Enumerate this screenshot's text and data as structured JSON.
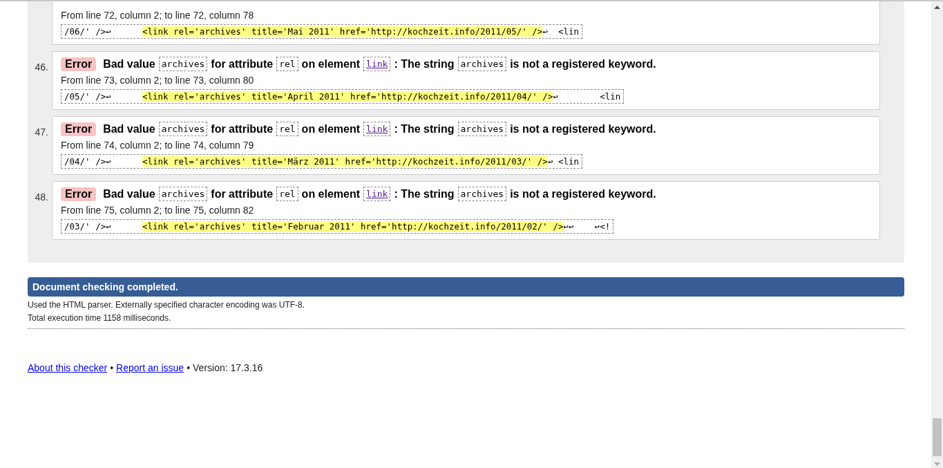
{
  "messages": [
    {
      "location": "From line 72, column 2; to line 72, column 78",
      "extract": {
        "before": "/06/' />↩      ",
        "highlighted": "<link rel='archives' title='Mai 2011' href='http://kochzeit.info/2011/05/' />",
        "after": "↩  <lin"
      }
    },
    {
      "number": "46.",
      "type": "Error",
      "parts": [
        {
          "kind": "text",
          "text": "Bad value"
        },
        {
          "kind": "code",
          "text": "archives"
        },
        {
          "kind": "text",
          "text": "for attribute"
        },
        {
          "kind": "code",
          "text": "rel"
        },
        {
          "kind": "text",
          "text": "on element"
        },
        {
          "kind": "link",
          "text": "link"
        },
        {
          "kind": "text",
          "text": ": The string"
        },
        {
          "kind": "code",
          "text": "archives"
        },
        {
          "kind": "text",
          "text": "is not a registered keyword."
        }
      ],
      "location": "From line 73, column 2; to line 73, column 80",
      "extract": {
        "before": "/05/' />↩      ",
        "highlighted": "<link rel='archives' title='April 2011' href='http://kochzeit.info/2011/04/' />",
        "after": "↩        <lin"
      }
    },
    {
      "number": "47.",
      "type": "Error",
      "parts": [
        {
          "kind": "text",
          "text": "Bad value"
        },
        {
          "kind": "code",
          "text": "archives"
        },
        {
          "kind": "text",
          "text": "for attribute"
        },
        {
          "kind": "code",
          "text": "rel"
        },
        {
          "kind": "text",
          "text": "on element"
        },
        {
          "kind": "link",
          "text": "link"
        },
        {
          "kind": "text",
          "text": ": The string"
        },
        {
          "kind": "code",
          "text": "archives"
        },
        {
          "kind": "text",
          "text": "is not a registered keyword."
        }
      ],
      "location": "From line 74, column 2; to line 74, column 79",
      "extract": {
        "before": "/04/' />↩      ",
        "highlighted": "<link rel='archives' title='März 2011' href='http://kochzeit.info/2011/03/' />",
        "after": "↩ <lin"
      }
    },
    {
      "number": "48.",
      "type": "Error",
      "parts": [
        {
          "kind": "text",
          "text": "Bad value"
        },
        {
          "kind": "code",
          "text": "archives"
        },
        {
          "kind": "text",
          "text": "for attribute"
        },
        {
          "kind": "code",
          "text": "rel"
        },
        {
          "kind": "text",
          "text": "on element"
        },
        {
          "kind": "link",
          "text": "link"
        },
        {
          "kind": "text",
          "text": ": The string"
        },
        {
          "kind": "code",
          "text": "archives"
        },
        {
          "kind": "text",
          "text": "is not a registered keyword."
        }
      ],
      "location": "From line 75, column 2; to line 75, column 82",
      "extract": {
        "before": "/03/' />↩      ",
        "highlighted": "<link rel='archives' title='Februar 2011' href='http://kochzeit.info/2011/02/' />",
        "after": "↩↩    ↩<!"
      }
    }
  ],
  "completion": {
    "title": "Document checking completed.",
    "details": [
      "Used the HTML parser. Externally specified character encoding was UTF-8.",
      "Total execution time 1158 milliseconds."
    ]
  },
  "footer": {
    "links": [
      "About this checker",
      "Report an issue"
    ],
    "separator": "•",
    "version": "Version: 17.3.16"
  }
}
